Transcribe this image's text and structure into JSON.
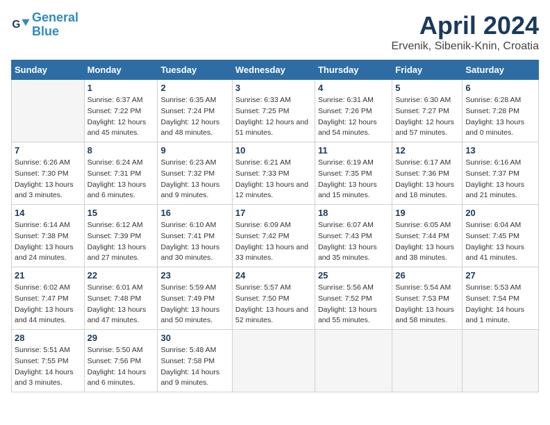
{
  "header": {
    "logo_line1": "General",
    "logo_line2": "Blue",
    "title": "April 2024",
    "subtitle": "Ervenik, Sibenik-Knin, Croatia"
  },
  "days_of_week": [
    "Sunday",
    "Monday",
    "Tuesday",
    "Wednesday",
    "Thursday",
    "Friday",
    "Saturday"
  ],
  "weeks": [
    [
      {
        "day": null
      },
      {
        "day": 1,
        "sunrise": "6:37 AM",
        "sunset": "7:22 PM",
        "daylight": "12 hours and 45 minutes."
      },
      {
        "day": 2,
        "sunrise": "6:35 AM",
        "sunset": "7:24 PM",
        "daylight": "12 hours and 48 minutes."
      },
      {
        "day": 3,
        "sunrise": "6:33 AM",
        "sunset": "7:25 PM",
        "daylight": "12 hours and 51 minutes."
      },
      {
        "day": 4,
        "sunrise": "6:31 AM",
        "sunset": "7:26 PM",
        "daylight": "12 hours and 54 minutes."
      },
      {
        "day": 5,
        "sunrise": "6:30 AM",
        "sunset": "7:27 PM",
        "daylight": "12 hours and 57 minutes."
      },
      {
        "day": 6,
        "sunrise": "6:28 AM",
        "sunset": "7:28 PM",
        "daylight": "13 hours and 0 minutes."
      }
    ],
    [
      {
        "day": 7,
        "sunrise": "6:26 AM",
        "sunset": "7:30 PM",
        "daylight": "13 hours and 3 minutes."
      },
      {
        "day": 8,
        "sunrise": "6:24 AM",
        "sunset": "7:31 PM",
        "daylight": "13 hours and 6 minutes."
      },
      {
        "day": 9,
        "sunrise": "6:23 AM",
        "sunset": "7:32 PM",
        "daylight": "13 hours and 9 minutes."
      },
      {
        "day": 10,
        "sunrise": "6:21 AM",
        "sunset": "7:33 PM",
        "daylight": "13 hours and 12 minutes."
      },
      {
        "day": 11,
        "sunrise": "6:19 AM",
        "sunset": "7:35 PM",
        "daylight": "13 hours and 15 minutes."
      },
      {
        "day": 12,
        "sunrise": "6:17 AM",
        "sunset": "7:36 PM",
        "daylight": "13 hours and 18 minutes."
      },
      {
        "day": 13,
        "sunrise": "6:16 AM",
        "sunset": "7:37 PM",
        "daylight": "13 hours and 21 minutes."
      }
    ],
    [
      {
        "day": 14,
        "sunrise": "6:14 AM",
        "sunset": "7:38 PM",
        "daylight": "13 hours and 24 minutes."
      },
      {
        "day": 15,
        "sunrise": "6:12 AM",
        "sunset": "7:39 PM",
        "daylight": "13 hours and 27 minutes."
      },
      {
        "day": 16,
        "sunrise": "6:10 AM",
        "sunset": "7:41 PM",
        "daylight": "13 hours and 30 minutes."
      },
      {
        "day": 17,
        "sunrise": "6:09 AM",
        "sunset": "7:42 PM",
        "daylight": "13 hours and 33 minutes."
      },
      {
        "day": 18,
        "sunrise": "6:07 AM",
        "sunset": "7:43 PM",
        "daylight": "13 hours and 35 minutes."
      },
      {
        "day": 19,
        "sunrise": "6:05 AM",
        "sunset": "7:44 PM",
        "daylight": "13 hours and 38 minutes."
      },
      {
        "day": 20,
        "sunrise": "6:04 AM",
        "sunset": "7:45 PM",
        "daylight": "13 hours and 41 minutes."
      }
    ],
    [
      {
        "day": 21,
        "sunrise": "6:02 AM",
        "sunset": "7:47 PM",
        "daylight": "13 hours and 44 minutes."
      },
      {
        "day": 22,
        "sunrise": "6:01 AM",
        "sunset": "7:48 PM",
        "daylight": "13 hours and 47 minutes."
      },
      {
        "day": 23,
        "sunrise": "5:59 AM",
        "sunset": "7:49 PM",
        "daylight": "13 hours and 50 minutes."
      },
      {
        "day": 24,
        "sunrise": "5:57 AM",
        "sunset": "7:50 PM",
        "daylight": "13 hours and 52 minutes."
      },
      {
        "day": 25,
        "sunrise": "5:56 AM",
        "sunset": "7:52 PM",
        "daylight": "13 hours and 55 minutes."
      },
      {
        "day": 26,
        "sunrise": "5:54 AM",
        "sunset": "7:53 PM",
        "daylight": "13 hours and 58 minutes."
      },
      {
        "day": 27,
        "sunrise": "5:53 AM",
        "sunset": "7:54 PM",
        "daylight": "14 hours and 1 minute."
      }
    ],
    [
      {
        "day": 28,
        "sunrise": "5:51 AM",
        "sunset": "7:55 PM",
        "daylight": "14 hours and 3 minutes."
      },
      {
        "day": 29,
        "sunrise": "5:50 AM",
        "sunset": "7:56 PM",
        "daylight": "14 hours and 6 minutes."
      },
      {
        "day": 30,
        "sunrise": "5:48 AM",
        "sunset": "7:58 PM",
        "daylight": "14 hours and 9 minutes."
      },
      {
        "day": null
      },
      {
        "day": null
      },
      {
        "day": null
      },
      {
        "day": null
      }
    ]
  ]
}
